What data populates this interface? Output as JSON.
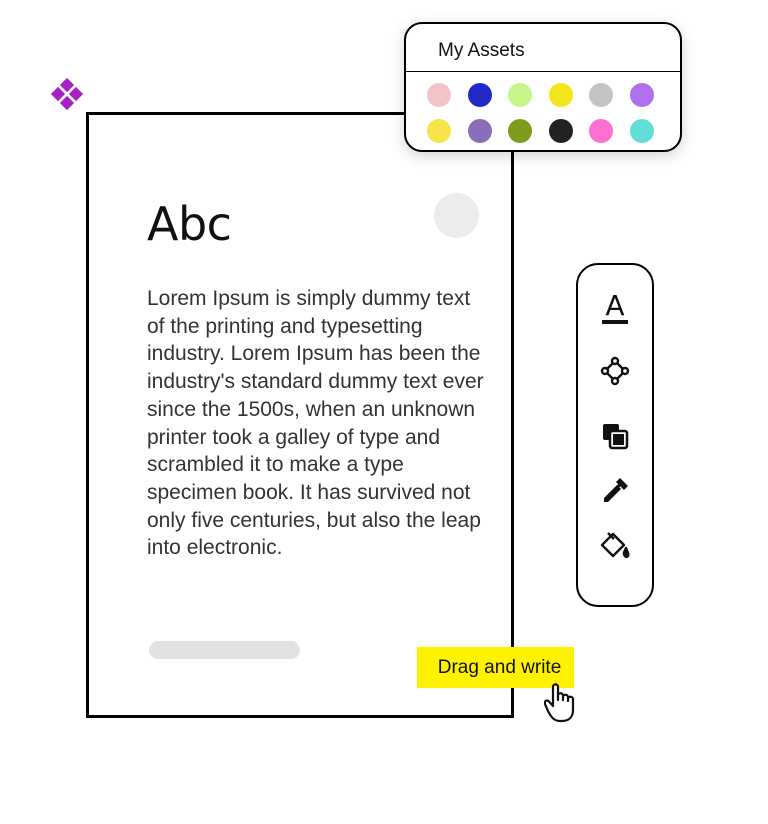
{
  "card": {
    "title": "Abc",
    "body": "Lorem Ipsum is simply dummy text of the printing and typesetting industry. Lorem Ipsum has been the industry's standard dummy text ever since the 1500s, when an unknown printer took a galley of type and scrambled it to make a type specimen book. It has survived not only five centuries, but also the leap into electronic."
  },
  "assets": {
    "title": "My Assets",
    "swatches": [
      "#f2c4c7",
      "#2228c8",
      "#c8f58a",
      "#f0e61a",
      "#c4c4c4",
      "#b070ee",
      "#f5e54a",
      "#8a6fb8",
      "#7e9c1c",
      "#222222",
      "#ff6fd2",
      "#62ded6"
    ]
  },
  "toolbar": {
    "tools": [
      "text-underline-icon",
      "vector-node-icon",
      "layers-icon",
      "eyedropper-icon",
      "paint-bucket-icon"
    ]
  },
  "drag": {
    "label": "Drag and write"
  },
  "colors": {
    "accent": "#fff200",
    "logo": "#a61fc4"
  }
}
